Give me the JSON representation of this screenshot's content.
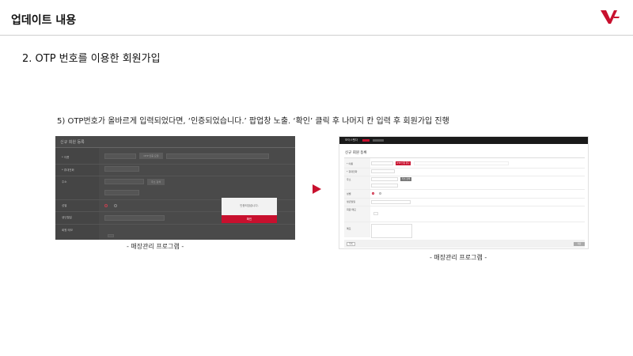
{
  "header": {
    "title": "업데이트 내용",
    "logo_icon": "vf-logo-icon"
  },
  "section": {
    "title": "2. OTP 번호를 이용한 회원가입"
  },
  "step": {
    "text": "5) OTP번호가 올바르게 입력되었다면, ‘인증되었습니다.’ 팝업창 노출. ‘확인’ 클릭 후 나머지 칸 입력 후 회원가입 진행"
  },
  "left_screenshot": {
    "form_title": "신규 회원 등록",
    "labels": [
      "* 이름",
      "* 휴대전화",
      "주소",
      "성별",
      "생년월일",
      "회원 메모"
    ],
    "otp_button": "OTP 인증 요청",
    "address_button": "주소 검색",
    "popup": {
      "message": "인증되었습니다.",
      "confirm": "확인"
    }
  },
  "right_screenshot": {
    "topbar_text": "보이스펫다",
    "form_title": "신규 회원 등록",
    "labels": [
      "* 이름",
      "* 휴대전화",
      "주소",
      "성별",
      "생년월일",
      "회원 메모",
      "메모"
    ],
    "verify_button": "OTP 인증 완료",
    "search_button": "주소 검색",
    "list_button": "목록",
    "save_button": "저장"
  },
  "captions": {
    "left": "- 매장관리 프로그램 -",
    "right": "- 매장관리 프로그램 -"
  },
  "colors": {
    "accent": "#c8102e"
  }
}
